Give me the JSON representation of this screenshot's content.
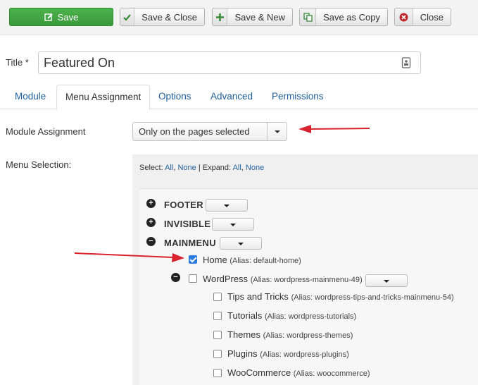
{
  "toolbar": {
    "save": {
      "label": "Save",
      "icon": "edit-icon"
    },
    "save_close": {
      "label": "Save & Close",
      "icon": "check-icon"
    },
    "save_new": {
      "label": "Save & New",
      "icon": "plus-icon"
    },
    "save_copy": {
      "label": "Save as Copy",
      "icon": "copy-icon"
    },
    "close": {
      "label": "Close",
      "icon": "close-icon"
    }
  },
  "title_field": {
    "label": "Title *",
    "value": "Featured On"
  },
  "tabs": [
    {
      "label": "Module"
    },
    {
      "label": "Menu Assignment"
    },
    {
      "label": "Options"
    },
    {
      "label": "Advanced"
    },
    {
      "label": "Permissions"
    }
  ],
  "module_assignment": {
    "label": "Module Assignment",
    "selected": "Only on the pages selected"
  },
  "menu_selection": {
    "label": "Menu Selection:",
    "select_label": "Select:",
    "all": "All",
    "none": "None",
    "sep": "|",
    "expand_label": "Expand:",
    "comma": ","
  },
  "menus": [
    {
      "name": "FOOTER"
    },
    {
      "name": "INVISIBLE"
    },
    {
      "name": "MAINMENU"
    }
  ],
  "items": [
    {
      "title": "Home",
      "alias": "(Alias: default-home)"
    },
    {
      "title": "WordPress",
      "alias": "(Alias: wordpress-mainmenu-49)"
    },
    {
      "title": "Tips and Tricks",
      "alias": "(Alias: wordpress-tips-and-tricks-mainmenu-54)"
    },
    {
      "title": "Tutorials",
      "alias": "(Alias: wordpress-tutorials)"
    },
    {
      "title": "Themes",
      "alias": "(Alias: wordpress-themes)"
    },
    {
      "title": "Plugins",
      "alias": "(Alias: wordpress-plugins)"
    },
    {
      "title": "WooCommerce",
      "alias": "(Alias: woocommerce)"
    }
  ],
  "colors": {
    "save_green": "#3a9a3a",
    "link_blue": "#1f5fa0",
    "arrow_red": "#d9232e",
    "check_blue": "#2a7ae2"
  }
}
